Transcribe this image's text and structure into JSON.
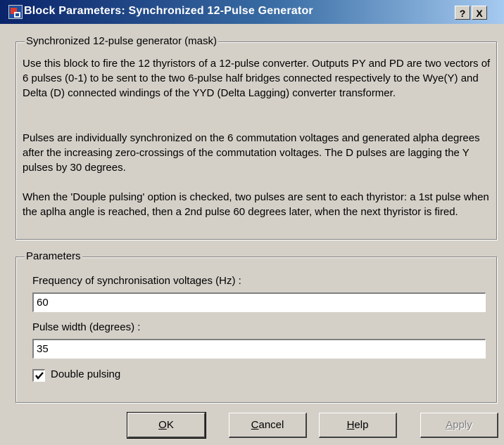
{
  "window": {
    "title": "Block Parameters: Synchronized 12-Pulse Generator",
    "help_button": "?",
    "close_button": "X"
  },
  "description": {
    "group_title": "Synchronized 12-pulse generator (mask)",
    "paragraphs": [
      "Use this block to fire the 12 thyristors of a 12-pulse converter. Outputs PY and PD are two vectors of 6 pulses (0-1) to be sent to the two 6-pulse half bridges connected respectively to the Wye(Y) and Delta (D) connected windings of the YYD (Delta Lagging)  converter transformer.",
      "Pulses are individually synchronized on the 6 commutation voltages and generated alpha degrees after the increasing zero-crossings of the commutation voltages. The D pulses are lagging the Y pulses by  30 degrees.",
      "When the 'Douple pulsing' option is checked, two pulses are sent to each thyristor: a 1st pulse when the aplha angle is reached, then a 2nd pulse 60 degrees later, when the next thyristor is fired."
    ]
  },
  "parameters": {
    "group_title": "Parameters",
    "frequency_label": "Frequency of synchronisation voltages (Hz) :",
    "frequency_value": "60",
    "pulse_width_label": "Pulse width (degrees) :",
    "pulse_width_value": "35",
    "double_pulsing_label": "Double pulsing",
    "double_pulsing_checked": true
  },
  "buttons": {
    "ok": {
      "mnemonic": "O",
      "rest": "K"
    },
    "cancel": {
      "mnemonic": "C",
      "rest": "ancel"
    },
    "help": {
      "mnemonic": "H",
      "rest": "elp"
    },
    "apply": {
      "mnemonic": "A",
      "rest": "pply"
    }
  }
}
